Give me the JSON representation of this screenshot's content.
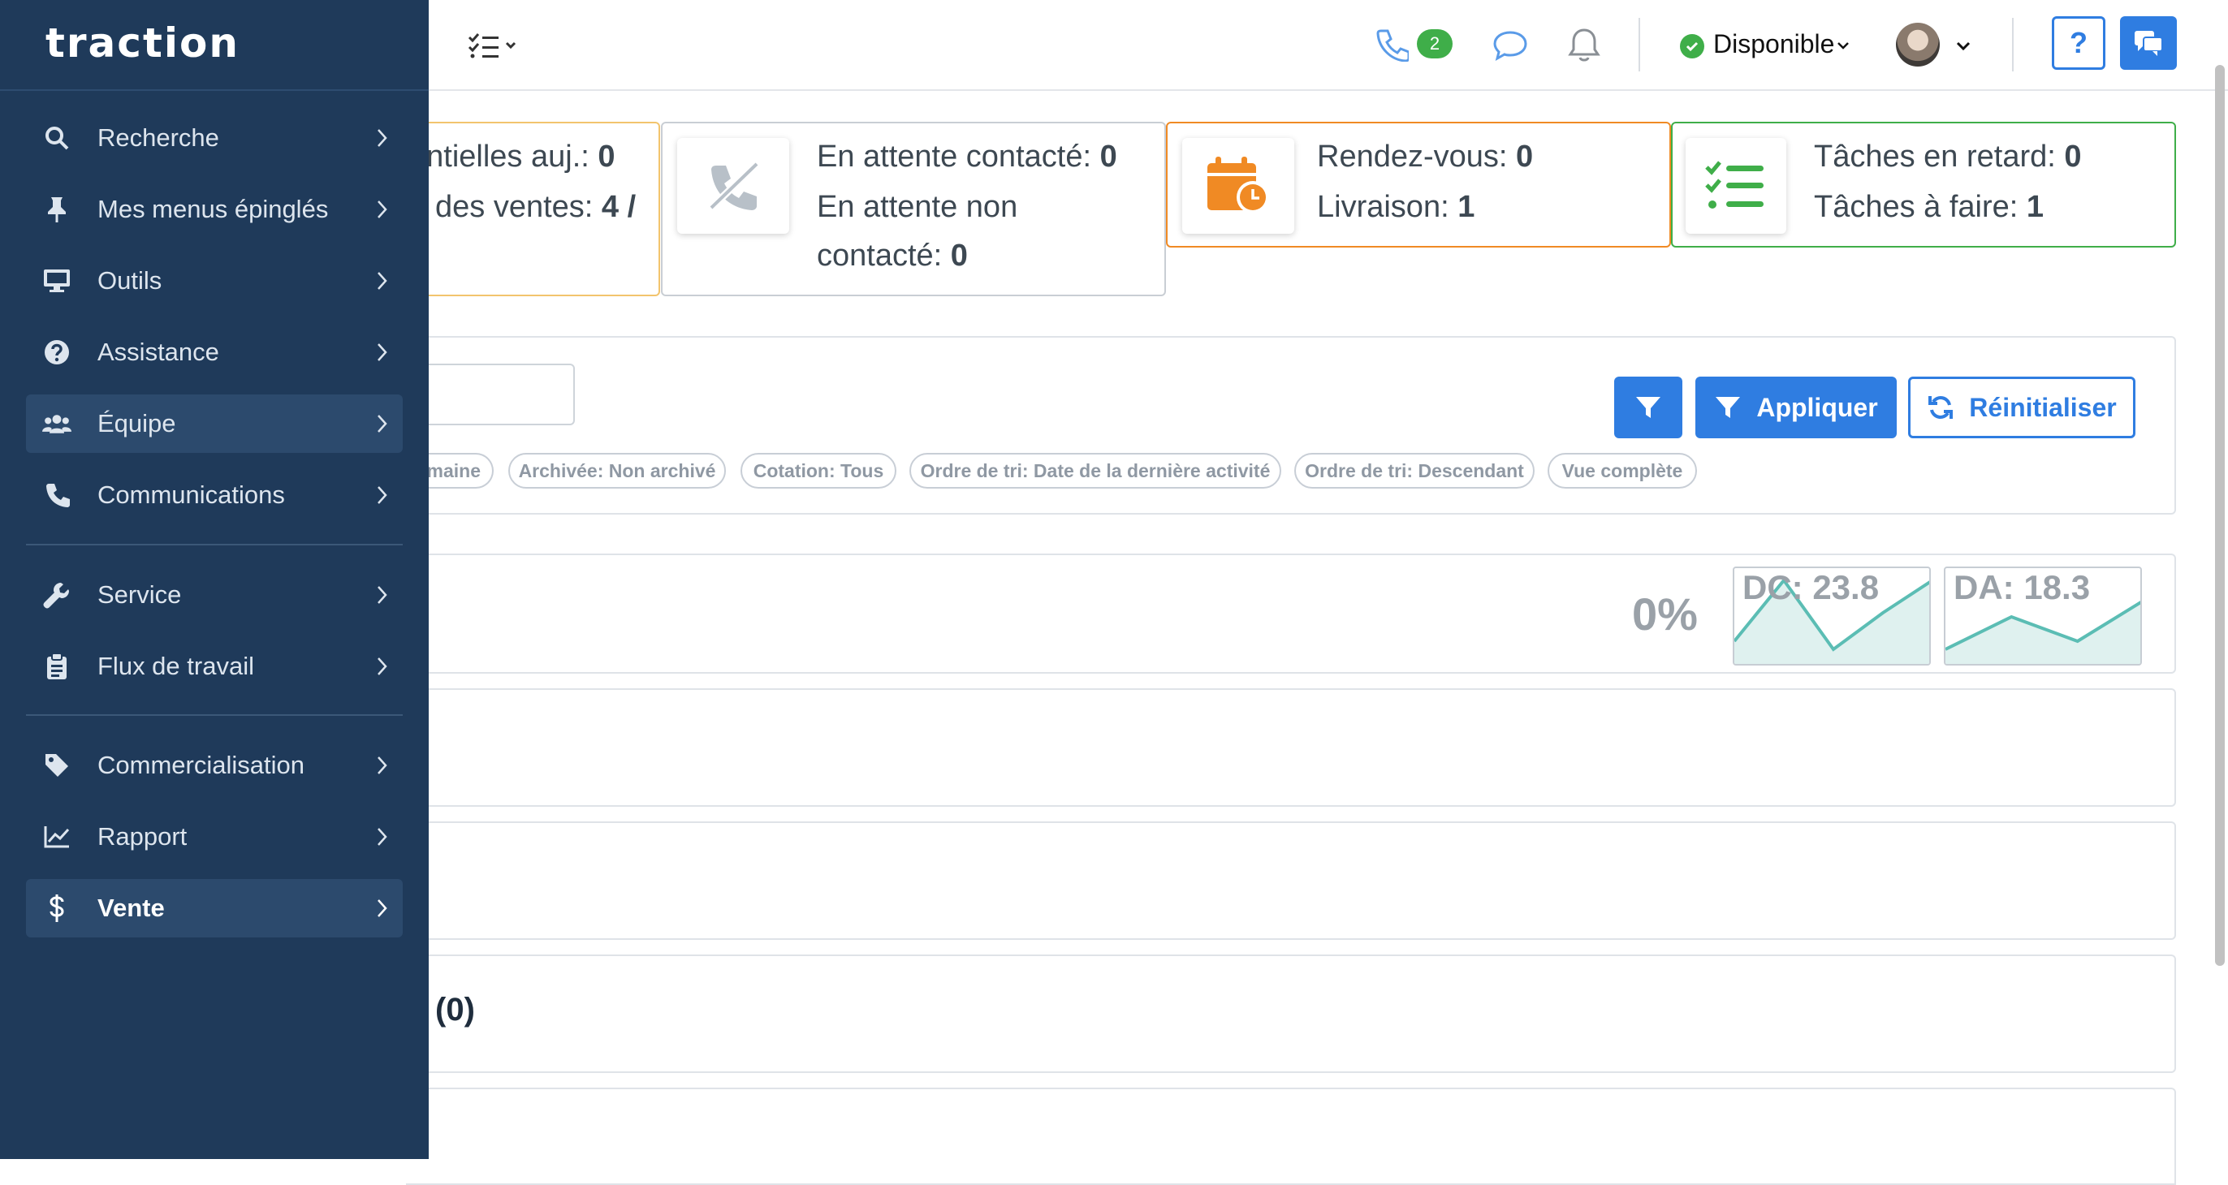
{
  "app": {
    "logo": "traction"
  },
  "header": {
    "phone_badge": "2",
    "status_label": "Disponible",
    "help_label": "?"
  },
  "cards": [
    {
      "line1": "entielles auj.: ",
      "value1": "0",
      "line2": "des ventes: ",
      "value2": "4 /"
    },
    {
      "line1": "En attente contacté: ",
      "value1": "0",
      "line2": "En attente non",
      "line3": "contacté: ",
      "value3": "0"
    },
    {
      "line1": "Rendez-vous: ",
      "value1": "0",
      "line2": "Livraison: ",
      "value2": "1"
    },
    {
      "line1": "Tâches en retard: ",
      "value1": "0",
      "line2": "Tâches à faire: ",
      "value2": "1"
    }
  ],
  "filters": {
    "apply_label": "Appliquer",
    "reset_label": "Réinitialiser",
    "chips": [
      "maine",
      "Archivée: Non archivé",
      "Cotation: Tous",
      "Ordre de tri: Date de la dernière activité",
      "Ordre de tri: Descendant",
      "Vue complète"
    ]
  },
  "stats": {
    "percent": "0%",
    "sparklines": [
      {
        "label": "DC: 23.8",
        "values": [
          0.2,
          0.95,
          0.1,
          0.55,
          0.95
        ]
      },
      {
        "label": "DA: 18.3",
        "values": [
          0.1,
          0.5,
          0.2,
          0.7
        ]
      }
    ]
  },
  "sections": {
    "count_label": "(0)"
  },
  "sidebar": {
    "items": [
      {
        "label": "Recherche",
        "icon": "search-icon"
      },
      {
        "label": "Mes menus épinglés",
        "icon": "pin-icon"
      },
      {
        "label": "Outils",
        "icon": "monitor-icon"
      },
      {
        "label": "Assistance",
        "icon": "question-circle-icon"
      },
      {
        "label": "Équipe",
        "icon": "users-icon"
      },
      {
        "label": "Communications",
        "icon": "phone-icon"
      },
      {
        "label": "Service",
        "icon": "wrench-icon"
      },
      {
        "label": "Flux de travail",
        "icon": "clipboard-icon"
      },
      {
        "label": "Commercialisation",
        "icon": "tag-icon"
      },
      {
        "label": "Rapport",
        "icon": "chart-line-icon"
      },
      {
        "label": "Vente",
        "icon": "dollar-icon"
      }
    ]
  },
  "colors": {
    "sidebar_bg": "#1f3a5a",
    "accent": "#2f7de1",
    "success": "#3fae49",
    "warning": "#f08a24",
    "yellow_border": "#f2c46d"
  }
}
